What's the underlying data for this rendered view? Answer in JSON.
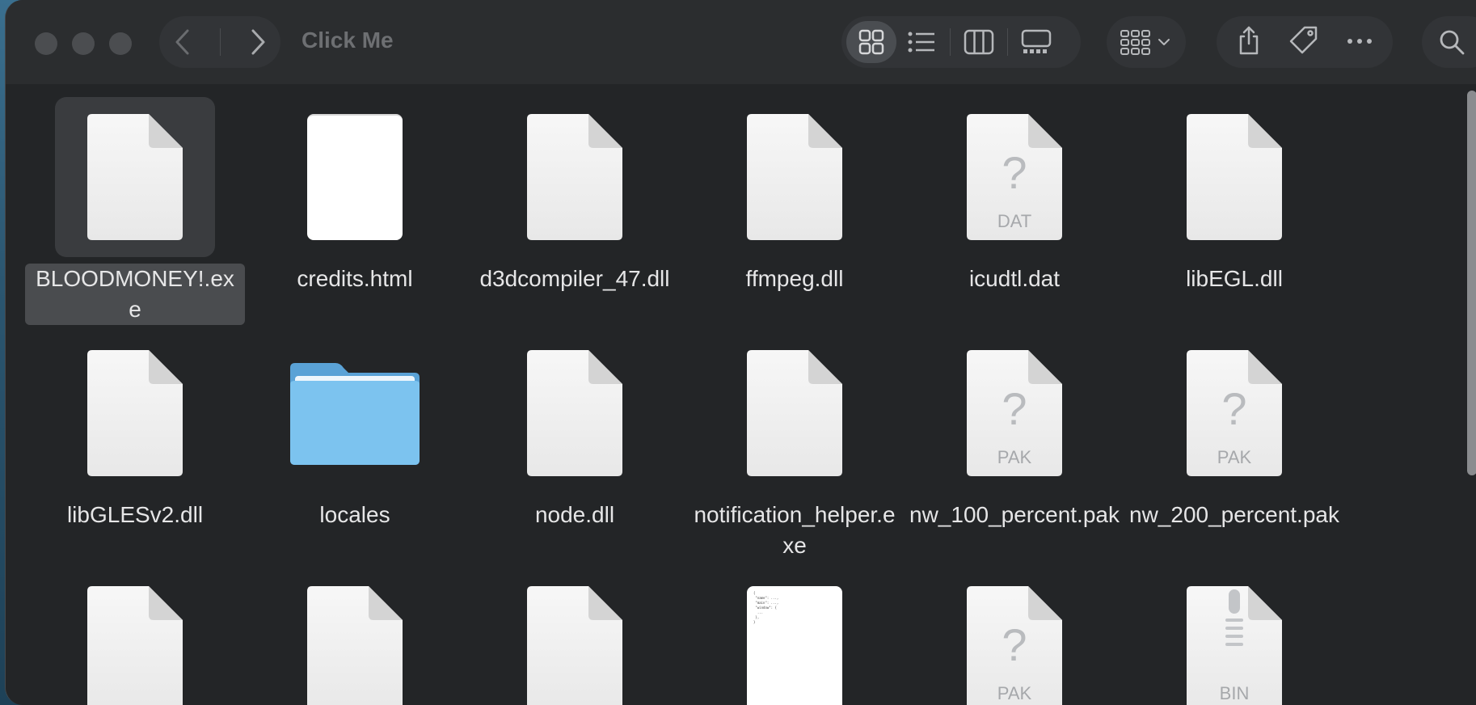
{
  "window": {
    "title": "Click Me"
  },
  "toolbar": {
    "back_icon": "chevron-left-icon",
    "forward_icon": "chevron-right-icon",
    "views": [
      "icon-view",
      "list-view",
      "column-view",
      "gallery-view"
    ],
    "active_view": "icon-view",
    "group_icon": "group-by-icon",
    "actions": [
      "share-icon",
      "tag-icon",
      "more-icon"
    ],
    "search_icon": "search-icon"
  },
  "colors": {
    "window_bg": "#252729",
    "toolbar_bg": "#2b2d2f",
    "folder_blue": "#6bb7ea",
    "text": "#e6e6e7"
  },
  "files": [
    {
      "name": "BLOODMONEY!.exe",
      "kind": "doc",
      "selected": true
    },
    {
      "name": "credits.html",
      "kind": "blank"
    },
    {
      "name": "d3dcompiler_47.dll",
      "kind": "doc"
    },
    {
      "name": "ffmpeg.dll",
      "kind": "doc"
    },
    {
      "name": "icudtl.dat",
      "kind": "unknown",
      "ext": "DAT"
    },
    {
      "name": "libEGL.dll",
      "kind": "doc"
    },
    {
      "name": "libGLESv2.dll",
      "kind": "doc"
    },
    {
      "name": "locales",
      "kind": "folder"
    },
    {
      "name": "node.dll",
      "kind": "doc"
    },
    {
      "name": "notification_helper.exe",
      "kind": "doc"
    },
    {
      "name": "nw_100_percent.pak",
      "kind": "unknown",
      "ext": "PAK"
    },
    {
      "name": "nw_200_percent.pak",
      "kind": "unknown",
      "ext": "PAK"
    },
    {
      "name": "",
      "kind": "doc"
    },
    {
      "name": "",
      "kind": "doc"
    },
    {
      "name": "",
      "kind": "doc"
    },
    {
      "name": "",
      "kind": "json"
    },
    {
      "name": "",
      "kind": "unknown",
      "ext": "PAK"
    },
    {
      "name": "",
      "kind": "zip",
      "ext": "BIN"
    }
  ]
}
